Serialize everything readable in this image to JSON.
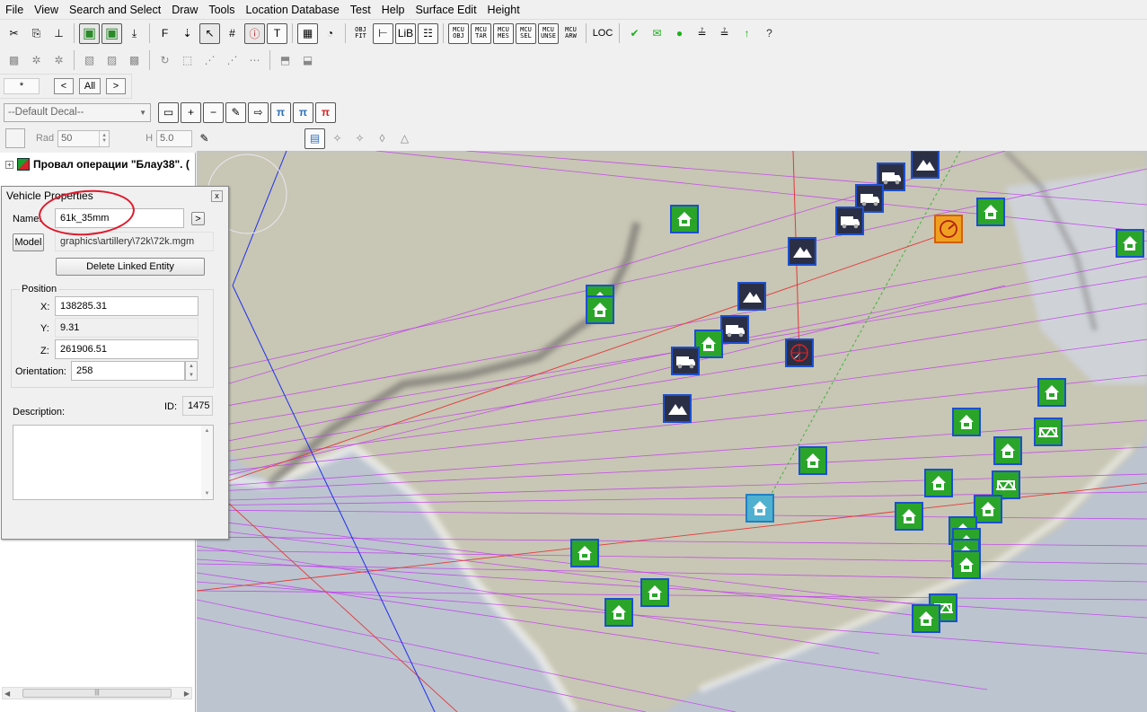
{
  "menu": [
    "File",
    "View",
    "Search and Select",
    "Draw",
    "Tools",
    "Location Database",
    "Test",
    "Help",
    "Surface Edit",
    "Height"
  ],
  "toolbar1": {
    "buttons": [
      {
        "name": "cut-icon",
        "glyph": "✂"
      },
      {
        "name": "copy-icon",
        "glyph": "⎘"
      },
      {
        "name": "ruler-icon",
        "glyph": "⊥"
      },
      {
        "name": "layers-green-icon",
        "glyph": "▣"
      },
      {
        "name": "layers-stack-icon",
        "glyph": "▣"
      },
      {
        "name": "download-icon",
        "glyph": "⤓"
      },
      {
        "name": "font-f-icon",
        "glyph": "F"
      },
      {
        "name": "terrain-down-icon",
        "glyph": "⇣"
      },
      {
        "name": "select-z-icon",
        "glyph": "↖"
      },
      {
        "name": "grid-hash-icon",
        "glyph": "#"
      },
      {
        "name": "info-box-icon",
        "glyph": "ⓘ"
      },
      {
        "name": "text-mode-icon",
        "glyph": "T"
      },
      {
        "name": "graph-mode-icon",
        "glyph": "▦"
      },
      {
        "name": "compass-icon",
        "glyph": "◔"
      }
    ],
    "mini_buttons_a": [
      {
        "name": "obj-fit-button",
        "l1": "OBJ",
        "l2": "FIT"
      },
      {
        "name": "hierarchy-icon",
        "glyph": "⊢"
      },
      {
        "name": "lib-button",
        "glyph": "LiB"
      },
      {
        "name": "list-prop-icon",
        "glyph": "☷"
      }
    ],
    "mini_buttons_b": [
      {
        "name": "mcu-obj-button",
        "l1": "MCU",
        "l2": "OBJ"
      },
      {
        "name": "mcu-tar-button",
        "l1": "MCU",
        "l2": "TAR"
      },
      {
        "name": "mcu-mes-button",
        "l1": "MCU",
        "l2": "MES"
      },
      {
        "name": "mcu-sel-button",
        "l1": "MCU",
        "l2": "SEL"
      },
      {
        "name": "mcu-unse-button",
        "l1": "MCU",
        "l2": "UNSE"
      },
      {
        "name": "mcu-arw-button",
        "l1": "MCU",
        "l2": "ARW"
      }
    ],
    "loc_label": "LOC",
    "tail": [
      {
        "name": "check-icon",
        "glyph": "✔"
      },
      {
        "name": "envelope-icon",
        "glyph": "✉"
      },
      {
        "name": "dot-icon",
        "glyph": "●"
      },
      {
        "name": "layer-1-icon",
        "glyph": "≟"
      },
      {
        "name": "layer-2-icon",
        "glyph": "≟"
      },
      {
        "name": "arrow-up-icon",
        "glyph": "↑"
      },
      {
        "name": "help-icon",
        "glyph": "?"
      }
    ]
  },
  "toolbar2": [
    {
      "name": "terrain-grid-icon",
      "glyph": "▩"
    },
    {
      "name": "wand-icon",
      "glyph": "✲"
    },
    {
      "name": "wand-plus-icon",
      "glyph": "✲"
    },
    {
      "name": "photo-icon",
      "glyph": "▧"
    },
    {
      "name": "image-icon",
      "glyph": "▨"
    },
    {
      "name": "checker-icon",
      "glyph": "▩"
    },
    {
      "name": "rotate-icon",
      "glyph": "↻"
    },
    {
      "name": "select-box-icon",
      "glyph": "⬚"
    },
    {
      "name": "path-add-icon",
      "glyph": "⋰"
    },
    {
      "name": "path-node-icon",
      "glyph": "⋰"
    },
    {
      "name": "path-edit-icon",
      "glyph": "⋯"
    },
    {
      "name": "object-push-icon",
      "glyph": "⬒"
    },
    {
      "name": "object-pull-icon",
      "glyph": "⬓"
    }
  ],
  "row3": {
    "star_label": "*",
    "prev_label": "<",
    "all_label": "All",
    "next_label": ">"
  },
  "row4": {
    "decal_dropdown": "--Default Decal--",
    "buttons": [
      {
        "name": "decal-frame-icon",
        "glyph": "▭"
      },
      {
        "name": "plus-icon",
        "glyph": "+"
      },
      {
        "name": "minus-icon",
        "glyph": "−"
      },
      {
        "name": "eyedropper-icon",
        "glyph": "✎"
      },
      {
        "name": "arrow-into-icon",
        "glyph": "⇨"
      },
      {
        "name": "pi-scatter-icon",
        "glyph": "π"
      },
      {
        "name": "pi-check-icon",
        "glyph": "π"
      },
      {
        "name": "pi-red-icon",
        "glyph": "π"
      }
    ]
  },
  "row5": {
    "rad_label": "Rad",
    "rad_value": "50",
    "h_label": "H",
    "h_value": "5.0",
    "buttons": [
      {
        "name": "brush-fill-icon",
        "glyph": "▤"
      },
      {
        "name": "brush-add-icon",
        "glyph": "✧"
      },
      {
        "name": "brush-remove-icon",
        "glyph": "✧"
      },
      {
        "name": "drop-icon",
        "glyph": "◊"
      },
      {
        "name": "cone-icon",
        "glyph": "△"
      }
    ]
  },
  "tree": {
    "expander": "+",
    "label": "Провал операции \"Блау38\". ("
  },
  "vehicle_properties": {
    "title": "Vehicle Properties",
    "close": "x",
    "name_label": "Name:",
    "name_value": "61k_35mm",
    "next_btn": ">",
    "model_btn": "Model",
    "model_path": "graphics\\artillery\\72k\\72k.mgm",
    "delete_btn": "Delete Linked Entity",
    "position_label": "Position",
    "x_label": "X:",
    "x_value": "138285.31",
    "y_label": "Y:",
    "y_value": "9.31",
    "z_label": "Z:",
    "z_value": "261906.51",
    "orientation_label": "Orientation:",
    "orientation_value": "258",
    "description_label": "Description:",
    "id_label": "ID:",
    "id_value": "1475",
    "description_value": ""
  },
  "colors": {
    "accent_green": "#2aa52a",
    "icon_border_blue": "#1c4fd1",
    "route_purple": "#c23cf0",
    "route_red": "#e33a3a",
    "highlight_red": "#e0182b",
    "map_sea": "#b9c2cf",
    "map_land": "#c9c7b7"
  }
}
